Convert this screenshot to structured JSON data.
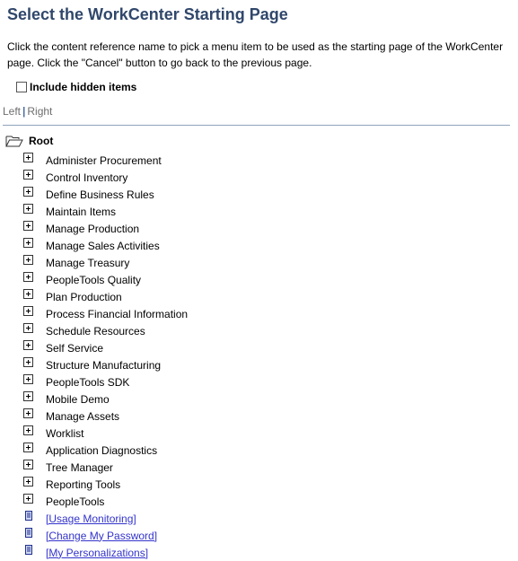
{
  "page": {
    "title": "Select the WorkCenter Starting Page",
    "instructions": "Click the content reference name to pick a menu item to be used as the starting page of the WorkCenter page. Click the \"Cancel\" button to go back to the previous page."
  },
  "include_hidden": {
    "label": "Include hidden items",
    "checked": false
  },
  "orientation": {
    "left": "Left",
    "separator": "|",
    "right": "Right"
  },
  "tree": {
    "root_label": "Root",
    "folders": [
      "Administer Procurement",
      "Control Inventory",
      "Define Business Rules",
      "Maintain Items",
      "Manage Production",
      "Manage Sales Activities",
      "Manage Treasury",
      "PeopleTools Quality",
      "Plan Production",
      "Process Financial Information",
      "Schedule Resources",
      "Self Service",
      "Structure Manufacturing",
      "PeopleTools SDK",
      "Mobile Demo",
      "Manage Assets",
      "Worklist",
      "Application Diagnostics",
      "Tree Manager",
      "Reporting Tools",
      "PeopleTools"
    ],
    "links": [
      "[Usage Monitoring]",
      "[Change My Password]",
      "[My Personalizations]"
    ]
  }
}
